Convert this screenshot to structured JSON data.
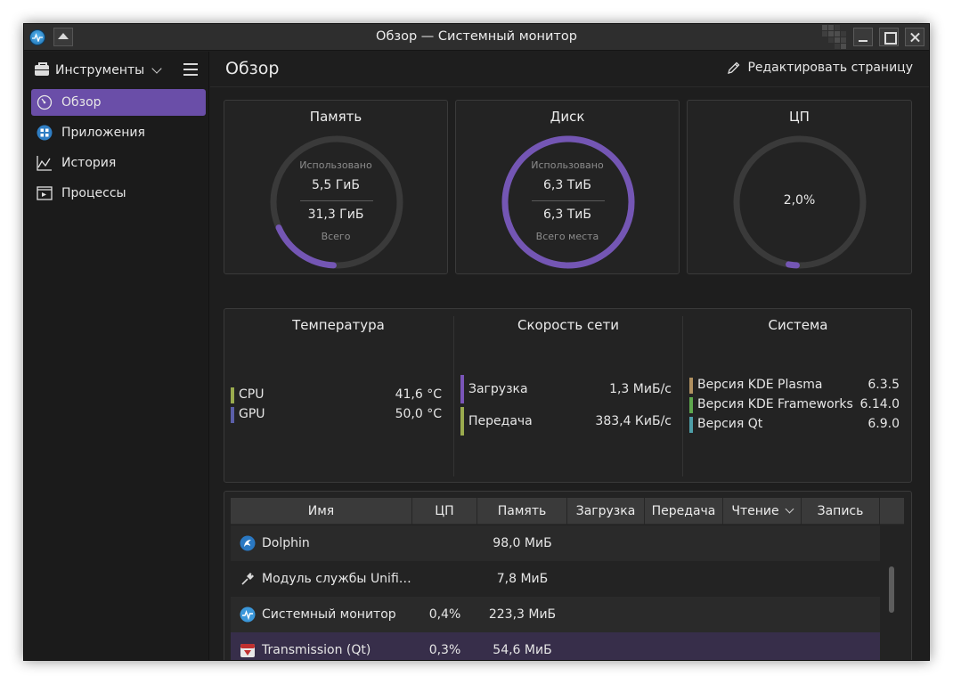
{
  "window": {
    "title": "Обзор — Системный монитор"
  },
  "sidebar": {
    "tools_label": "Инструменты",
    "items": [
      {
        "label": "Обзор",
        "icon": "gauge-icon",
        "active": true
      },
      {
        "label": "Приложения",
        "icon": "apps-icon"
      },
      {
        "label": "История",
        "icon": "chart-icon"
      },
      {
        "label": "Процессы",
        "icon": "terminal-icon"
      }
    ]
  },
  "header": {
    "title": "Обзор",
    "edit_label": "Редактировать страницу"
  },
  "memory": {
    "title": "Память",
    "used_label": "Использовано",
    "used": "5,5 ГиБ",
    "total": "31,3 ГиБ",
    "total_label": "Всего",
    "fraction": 0.176
  },
  "disk": {
    "title": "Диск",
    "used_label": "Использовано",
    "used": "6,3 ТиБ",
    "total": "6,3 ТиБ",
    "total_label": "Всего места",
    "fraction": 0.995
  },
  "cpu": {
    "title": "ЦП",
    "value": "2,0%",
    "fraction": 0.02
  },
  "temperature": {
    "title": "Температура",
    "rows": [
      {
        "label": "CPU",
        "value": "41,6 °C",
        "color": "#9aab4e"
      },
      {
        "label": "GPU",
        "value": "50,0 °C",
        "color": "#5b5fa8"
      }
    ]
  },
  "network": {
    "title": "Скорость сети",
    "rows": [
      {
        "label": "Загрузка",
        "value": "1,3 МиБ/с",
        "color": "#7a55b8"
      },
      {
        "label": "Передача",
        "value": "383,4 КиБ/с",
        "color": "#9aab4e"
      }
    ]
  },
  "system": {
    "title": "Система",
    "rows": [
      {
        "label": "Версия KDE Plasma",
        "value": "6.3.5",
        "color": "#b09060"
      },
      {
        "label": "Версия KDE Frameworks",
        "value": "6.14.0",
        "color": "#5fa84e"
      },
      {
        "label": "Версия Qt",
        "value": "6.9.0",
        "color": "#4e9fa8"
      }
    ]
  },
  "table": {
    "headers": {
      "name": "Имя",
      "cpu": "ЦП",
      "memory": "Память",
      "download": "Загрузка",
      "upload": "Передача",
      "read": "Чтение",
      "write": "Запись"
    },
    "rows": [
      {
        "name": "Dolphin",
        "cpu": "",
        "memory": "98,0 МиБ",
        "icon": "dolphin-icon"
      },
      {
        "name": "Модуль службы Unifi…",
        "cpu": "",
        "memory": "7,8 МиБ",
        "icon": "plug-icon"
      },
      {
        "name": "Системный монитор",
        "cpu": "0,4%",
        "memory": "223,3 МиБ",
        "icon": "system-monitor-icon"
      },
      {
        "name": "Transmission (Qt)",
        "cpu": "0,3%",
        "memory": "54,6 МиБ",
        "icon": "transmission-icon"
      }
    ]
  },
  "colors": {
    "accent": "#6a4ea8",
    "gauge_arc": "#7456b4",
    "gauge_track": "#3a3a3a"
  }
}
